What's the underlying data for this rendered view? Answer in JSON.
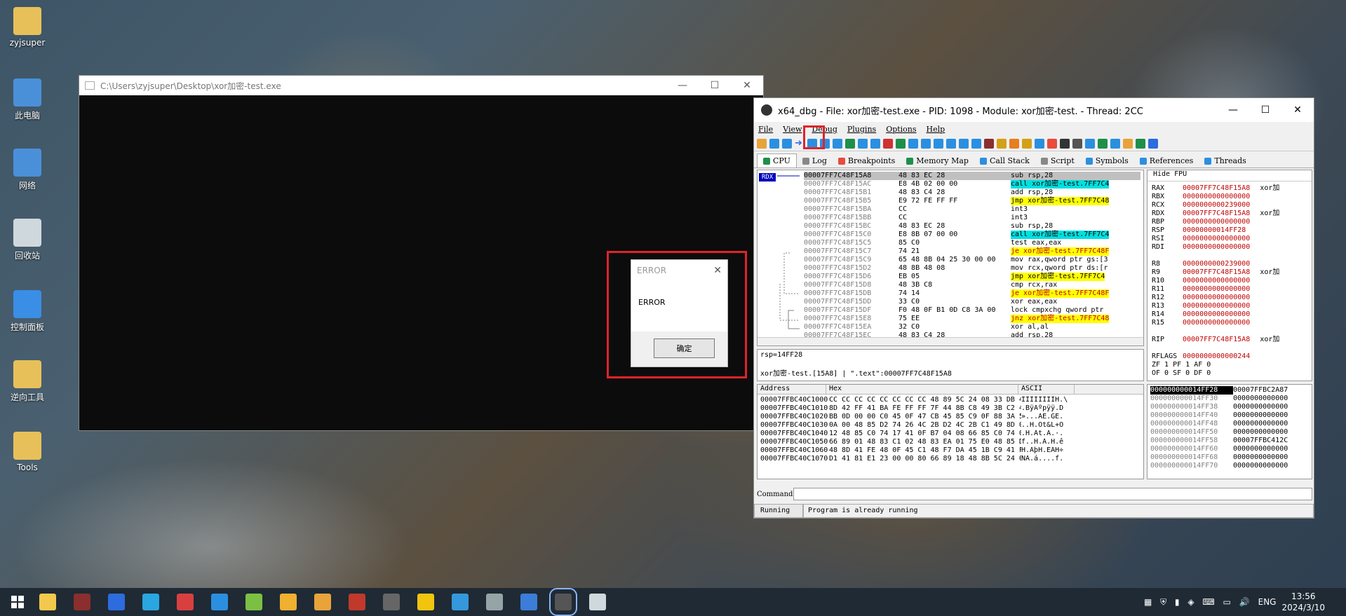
{
  "desktop": {
    "icons": [
      {
        "label": "zyjsuper",
        "icon": "user-folder-icon",
        "color": "#e8c05a"
      },
      {
        "label": "此电脑",
        "icon": "computer-icon",
        "color": "#4a90d9"
      },
      {
        "label": "网络",
        "icon": "network-icon",
        "color": "#4a90d9"
      },
      {
        "label": "回收站",
        "icon": "recycle-bin-icon",
        "color": "#cfd8dc"
      },
      {
        "label": "控制面板",
        "icon": "control-panel-icon",
        "color": "#3a8ee6"
      },
      {
        "label": "逆向工具",
        "icon": "tools-folder-icon",
        "color": "#e8c05a"
      },
      {
        "label": "Tools",
        "icon": "folder-icon",
        "color": "#e8c05a"
      }
    ]
  },
  "console": {
    "title": "C:\\Users\\zyjsuper\\Desktop\\xor加密-test.exe",
    "minimize": "—",
    "maximize": "☐",
    "close": "✕"
  },
  "error_dialog": {
    "title": "ERROR",
    "message": "ERROR",
    "ok_label": "确定",
    "close": "✕"
  },
  "debugger": {
    "title": "x64_dbg - File: xor加密-test.exe - PID: 1098 - Module: xor加密-test. - Thread: 2CC",
    "minimize": "—",
    "maximize": "☐",
    "close": "✕",
    "menu": [
      "File",
      "View",
      "Debug",
      "Plugins",
      "Options",
      "Help"
    ],
    "tabs": [
      "CPU",
      "Log",
      "Breakpoints",
      "Memory Map",
      "Call Stack",
      "Script",
      "Symbols",
      "References",
      "Threads"
    ],
    "rdx_tag": "RDX",
    "disasm": [
      {
        "addr": "00007FF7C48F15A8",
        "bytes": "48 83 EC 28",
        "instr": "sub rsp,28",
        "kind": "normal",
        "current": true
      },
      {
        "addr": "00007FF7C48F15AC",
        "bytes": "E8 4B 02 00 00",
        "instr": "call xor加密-test.7FF7C4",
        "kind": "call"
      },
      {
        "addr": "00007FF7C48F15B1",
        "bytes": "48 83 C4 28",
        "instr": "add rsp,28",
        "kind": "normal"
      },
      {
        "addr": "00007FF7C48F15B5",
        "bytes": "E9 72 FE FF FF",
        "instr": "jmp xor加密-test.7FF7C48",
        "kind": "jmp"
      },
      {
        "addr": "00007FF7C48F15BA",
        "bytes": "CC",
        "instr": "int3",
        "kind": "normal"
      },
      {
        "addr": "00007FF7C48F15BB",
        "bytes": "CC",
        "instr": "int3",
        "kind": "normal"
      },
      {
        "addr": "00007FF7C48F15BC",
        "bytes": "48 83 EC 28",
        "instr": "sub rsp,28",
        "kind": "normal"
      },
      {
        "addr": "00007FF7C48F15C0",
        "bytes": "E8 8B 07 00 00",
        "instr": "call xor加密-test.7FF7C4",
        "kind": "call"
      },
      {
        "addr": "00007FF7C48F15C5",
        "bytes": "85 C0",
        "instr": "test eax,eax",
        "kind": "normal"
      },
      {
        "addr": "00007FF7C48F15C7",
        "bytes": "74 21",
        "instr": "je xor加密-test.7FF7C48F",
        "kind": "je"
      },
      {
        "addr": "00007FF7C48F15C9",
        "bytes": "65 48 8B 04 25 30 00 00",
        "instr": "mov rax,qword ptr gs:[3",
        "kind": "normal"
      },
      {
        "addr": "00007FF7C48F15D2",
        "bytes": "48 8B 48 08",
        "instr": "mov rcx,qword ptr ds:[r",
        "kind": "normal"
      },
      {
        "addr": "00007FF7C48F15D6",
        "bytes": "EB 05",
        "instr": "jmp xor加密-test.7FF7C4",
        "kind": "jmp"
      },
      {
        "addr": "00007FF7C48F15D8",
        "bytes": "48 3B C8",
        "instr": "cmp rcx,rax",
        "kind": "normal"
      },
      {
        "addr": "00007FF7C48F15DB",
        "bytes": "74 14",
        "instr": "je xor加密-test.7FF7C48F",
        "kind": "je"
      },
      {
        "addr": "00007FF7C48F15DD",
        "bytes": "33 C0",
        "instr": "xor eax,eax",
        "kind": "normal"
      },
      {
        "addr": "00007FF7C48F15DF",
        "bytes": "F0 48 0F B1 0D C8 3A 00",
        "instr": "lock cmpxchg qword ptr",
        "kind": "normal"
      },
      {
        "addr": "00007FF7C48F15E8",
        "bytes": "75 EE",
        "instr": "jnz xor加密-test.7FF7C48",
        "kind": "je"
      },
      {
        "addr": "00007FF7C48F15EA",
        "bytes": "32 C0",
        "instr": "xor al,al",
        "kind": "normal"
      },
      {
        "addr": "00007FF7C48F15EC",
        "bytes": "48 83 C4 28",
        "instr": "add rsp,28",
        "kind": "normal"
      }
    ],
    "fpu_toggle": "Hide FPU",
    "registers": [
      {
        "name": "RAX",
        "value": "00007FF7C48F15A8",
        "note": "xor加"
      },
      {
        "name": "RBX",
        "value": "0000000000000000",
        "note": ""
      },
      {
        "name": "RCX",
        "value": "0000000000239000",
        "note": ""
      },
      {
        "name": "RDX",
        "value": "00007FF7C48F15A8",
        "note": "xor加"
      },
      {
        "name": "RBP",
        "value": "0000000000000000",
        "note": ""
      },
      {
        "name": "RSP",
        "value": "00000000014FF28",
        "note": ""
      },
      {
        "name": "RSI",
        "value": "0000000000000000",
        "note": ""
      },
      {
        "name": "RDI",
        "value": "0000000000000000",
        "note": ""
      },
      {
        "name": "",
        "value": "",
        "note": ""
      },
      {
        "name": "R8",
        "value": "0000000000239000",
        "note": ""
      },
      {
        "name": "R9",
        "value": "00007FF7C48F15A8",
        "note": "xor加"
      },
      {
        "name": "R10",
        "value": "0000000000000000",
        "note": ""
      },
      {
        "name": "R11",
        "value": "0000000000000000",
        "note": ""
      },
      {
        "name": "R12",
        "value": "0000000000000000",
        "note": ""
      },
      {
        "name": "R13",
        "value": "0000000000000000",
        "note": ""
      },
      {
        "name": "R14",
        "value": "0000000000000000",
        "note": ""
      },
      {
        "name": "R15",
        "value": "0000000000000000",
        "note": ""
      },
      {
        "name": "",
        "value": "",
        "note": ""
      },
      {
        "name": "RIP",
        "value": "00007FF7C48F15A8",
        "note": "xor加"
      },
      {
        "name": "",
        "value": "",
        "note": ""
      },
      {
        "name": "RFLAGS",
        "value": "0000000000000244",
        "note": ""
      }
    ],
    "flags_lines": [
      "ZF 1  PF 1  AF 0",
      "OF 0  SF 0  DF 0"
    ],
    "info_line1": "rsp=14FF28",
    "info_line2": "xor加密-test.[15A8] | \".text\":00007FF7C48F15A8",
    "dump_headers": [
      "Address",
      "Hex",
      "ASCII"
    ],
    "dump": [
      {
        "addr": "00007FFBC40C1000",
        "hex": "CC CC CC CC CC CC CC CC 48 89 5C 24 08 33 DB 48",
        "ascii": "ÌÌÌÌÌÌÌÌH.\\"
      },
      {
        "addr": "00007FFBC40C1010",
        "hex": "8D 42 FF 41 BA FE FF FF 7F 44 8B C8 49 3B C2 41",
        "ascii": ".BÿAºpÿÿ.D"
      },
      {
        "addr": "00007FFBC40C1020",
        "hex": "BB 0D 00 00 C0 45 0F 47 CB 45 85 C9 0F 88 3A 56",
        "ascii": "»...ÀE.GË."
      },
      {
        "addr": "00007FFBC40C1030",
        "hex": "0A 00 48 85 D2 74 26 4C 2B D2 4C 2B C1 49 8D 04",
        "ascii": "..H.Òt&L+Ò"
      },
      {
        "addr": "00007FFBC40C1040",
        "hex": "12 48 85 C0 74 17 41 0F B7 04 08 66 85 C0 74 0D",
        "ascii": ".H.Àt.A.·."
      },
      {
        "addr": "00007FFBC40C1050",
        "hex": "66 89 01 48 83 C1 02 48 83 EA 01 75 E0 48 85 D2",
        "ascii": "f..H.Á.H.ê"
      },
      {
        "addr": "00007FFBC40C1060",
        "hex": "48 8D 41 FE 48 0F 45 C1 48 F7 DA 45 1B C9 41 F7",
        "ascii": "H.AþH.EÁH÷"
      },
      {
        "addr": "00007FFBC40C1070",
        "hex": "D1 41 81 E1 23 00 00 80 66 89 18 48 8B 5C 24 08",
        "ascii": "ÑA.á....f."
      }
    ],
    "stack": [
      {
        "addr": "000000000014FF28",
        "value": "00007FFBC2A87",
        "current": true
      },
      {
        "addr": "000000000014FF30",
        "value": "0000000000000",
        "current": false
      },
      {
        "addr": "000000000014FF38",
        "value": "0000000000000",
        "current": false
      },
      {
        "addr": "000000000014FF40",
        "value": "0000000000000",
        "current": false
      },
      {
        "addr": "000000000014FF48",
        "value": "0000000000000",
        "current": false
      },
      {
        "addr": "000000000014FF50",
        "value": "0000000000000",
        "current": false
      },
      {
        "addr": "000000000014FF58",
        "value": "00007FFBC412C",
        "current": false
      },
      {
        "addr": "000000000014FF60",
        "value": "0000000000000",
        "current": false
      },
      {
        "addr": "000000000014FF68",
        "value": "0000000000000",
        "current": false
      },
      {
        "addr": "000000000014FF70",
        "value": "0000000000000",
        "current": false
      }
    ],
    "command_label": "Command:",
    "status_state": "Running",
    "status_message": "Program is already running"
  },
  "taskbar": {
    "apps": [
      {
        "icon": "file-explorer-icon",
        "color": "#f2c94c"
      },
      {
        "icon": "debugger-bug-icon",
        "color": "#8b2e2e"
      },
      {
        "icon": "pe-tool-icon",
        "color": "#2d6cdf"
      },
      {
        "icon": "vscode-icon",
        "color": "#2aa6e0"
      },
      {
        "icon": "hex-tool-icon",
        "color": "#d84040"
      },
      {
        "icon": "edge-icon",
        "color": "#2b8fe0"
      },
      {
        "icon": "notepadpp-icon",
        "color": "#7bc043"
      },
      {
        "icon": "sticky-icon",
        "color": "#f0b030"
      },
      {
        "icon": "chrome-icon",
        "color": "#e8a33b"
      },
      {
        "icon": "recorder-icon",
        "color": "#c0392b"
      },
      {
        "icon": "switch-icon",
        "color": "#666"
      },
      {
        "icon": "winhex-icon",
        "color": "#f1c40f"
      },
      {
        "icon": "network-tool-icon",
        "color": "#3498db"
      },
      {
        "icon": "remote-icon",
        "color": "#95a5a6"
      },
      {
        "icon": "wireshark-icon",
        "color": "#3b7dd8"
      },
      {
        "icon": "x64dbg-icon",
        "color": "#555"
      },
      {
        "icon": "console-icon",
        "color": "#cfd8dc"
      }
    ],
    "lang": "ENG",
    "time": "13:56",
    "date": "2024/3/10"
  }
}
